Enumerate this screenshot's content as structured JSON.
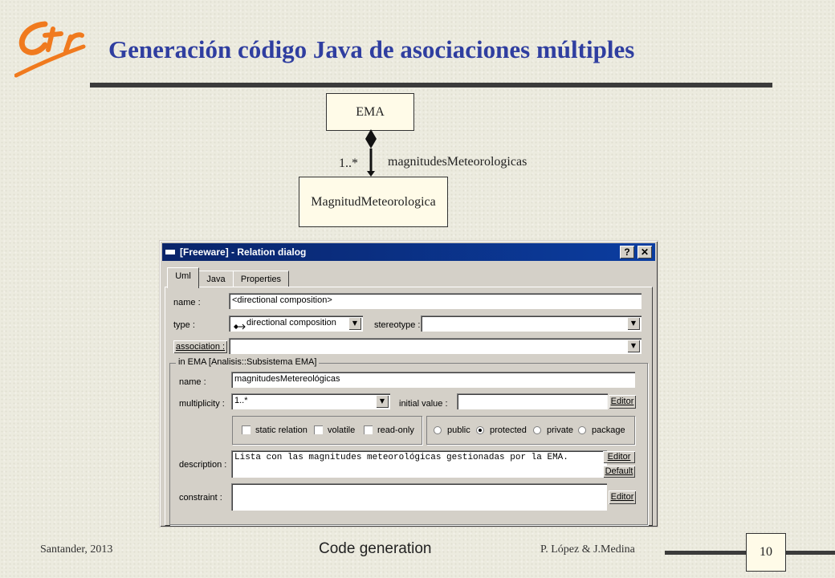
{
  "header": {
    "logo_text": "Ctr",
    "title": "Generación código Java de asociaciones múltiples"
  },
  "uml": {
    "class_ema": "EMA",
    "class_magnitud": "MagnitudMeteorologica",
    "multiplicity": "1..*",
    "role_name": "magnitudesMeteorologicas"
  },
  "dialog": {
    "title": "[Freeware] - Relation dialog",
    "help_button": "?",
    "close_button": "✕",
    "tabs": [
      {
        "label": "Uml"
      },
      {
        "label": "Java"
      },
      {
        "label": "Properties"
      }
    ],
    "name_label": "name :",
    "name_value": "<directional composition>",
    "type_label": "type :",
    "type_value": "directional composition",
    "stereotype_label": "stereotype :",
    "stereotype_value": "",
    "association_button": "association :",
    "association_value": "",
    "group_label": "in EMA   [Analisis::Subsistema EMA]",
    "role_name_label": "name :",
    "role_name_value": "magnitudesMetereológicas",
    "multiplicity_label": "multiplicity :",
    "multiplicity_value": "1..*",
    "initial_value_label": "initial value :",
    "initial_value": "",
    "editor_label": "Editor",
    "default_label": "Default",
    "checkboxes": [
      {
        "label": "static relation",
        "checked": false
      },
      {
        "label": "volatile",
        "checked": false
      },
      {
        "label": "read-only",
        "checked": false
      }
    ],
    "visibility": [
      {
        "label": "public",
        "selected": false
      },
      {
        "label": "protected",
        "selected": true
      },
      {
        "label": "private",
        "selected": false
      },
      {
        "label": "package",
        "selected": false
      }
    ],
    "description_label": "description :",
    "description_value": "Lista con las magnitudes meteorológicas gestionadas por la EMA.",
    "constraint_label": "constraint :",
    "constraint_value": ""
  },
  "footer": {
    "left": "Santander, 2013",
    "center": "Code generation",
    "right": "P. López & J.Medina",
    "page_number": "10"
  },
  "colors": {
    "title": "#2f3ea0",
    "logo": "#f07a1e",
    "titlebar": "#0a246a",
    "background": "#ecebdf"
  }
}
